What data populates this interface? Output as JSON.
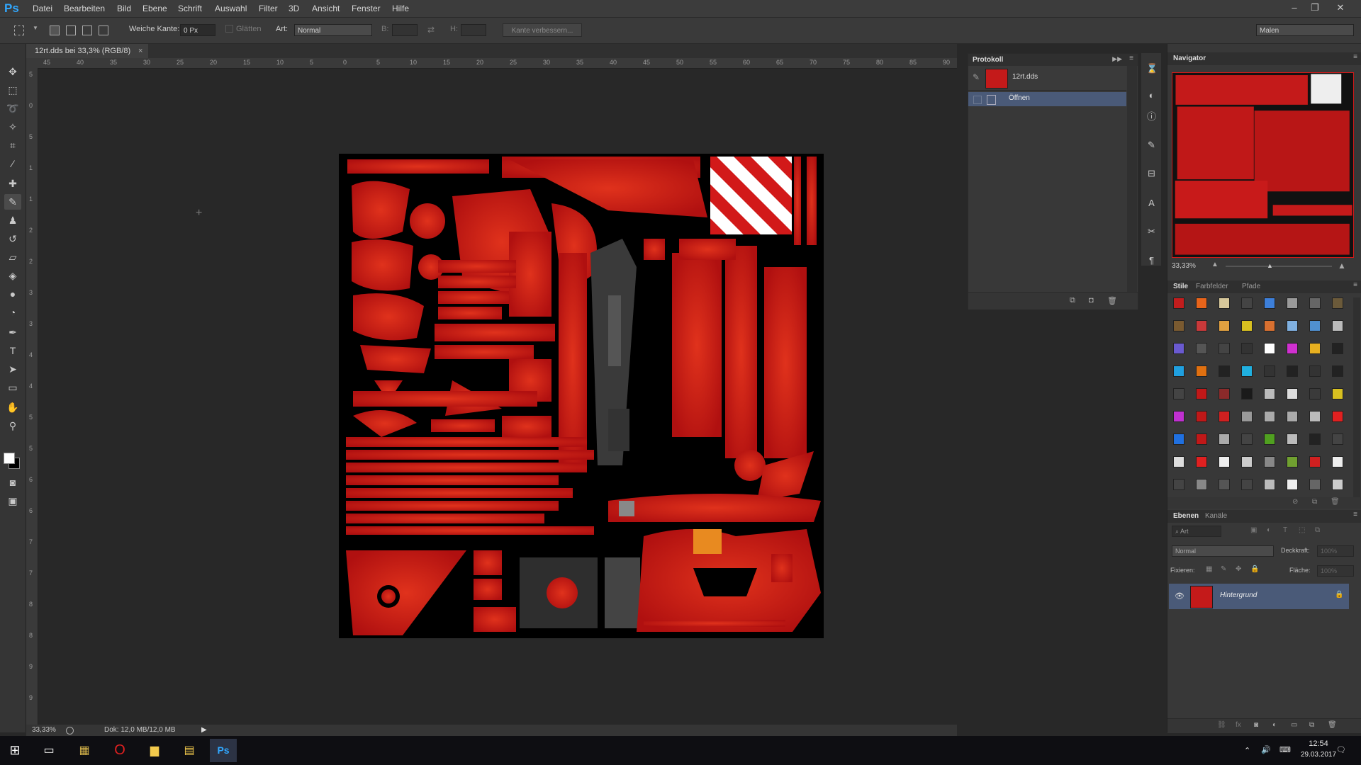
{
  "app": {
    "logo": "Ps"
  },
  "menu": [
    "Datei",
    "Bearbeiten",
    "Bild",
    "Ebene",
    "Schrift",
    "Auswahl",
    "Filter",
    "3D",
    "Ansicht",
    "Fenster",
    "Hilfe"
  ],
  "options": {
    "feather_label": "Weiche Kante:",
    "feather_value": "0 Px",
    "antialias_label": "Glätten",
    "style_label": "Art:",
    "style_value": "Normal",
    "width_label": "B:",
    "height_label": "H:",
    "refine_button": "Kante verbessern...",
    "workspace": "Malen"
  },
  "document": {
    "tab_title": "12rt.dds bei 33,3% (RGB/8)",
    "zoom": "33,33%",
    "doc_info": "Dok: 12,0 MB/12,0 MB"
  },
  "ruler_top": [
    "45",
    "40",
    "35",
    "30",
    "25",
    "20",
    "15",
    "10",
    "5",
    "0",
    "5",
    "10",
    "15",
    "20",
    "25",
    "30",
    "35",
    "40",
    "45",
    "50",
    "55",
    "60",
    "65",
    "70",
    "75",
    "80",
    "85",
    "90"
  ],
  "ruler_left": [
    "5",
    "0",
    "5",
    "1",
    "1",
    "2",
    "2",
    "3",
    "3",
    "4",
    "4",
    "5",
    "5",
    "6",
    "6",
    "7",
    "7",
    "8",
    "8",
    "9",
    "9"
  ],
  "history": {
    "title": "Protokoll",
    "snapshot": "12rt.dds",
    "items": [
      "Öffnen"
    ]
  },
  "navigator": {
    "title": "Navigator",
    "zoom": "33,33%"
  },
  "styles_panel": {
    "tabs": [
      "Stile",
      "Farbfelder",
      "Pfade"
    ]
  },
  "layers_panel": {
    "tabs": [
      "Ebenen",
      "Kanäle"
    ],
    "filter": "Art",
    "blend_mode": "Normal",
    "opacity_label": "Deckkraft:",
    "opacity_value": "100%",
    "lock_label": "Fixieren:",
    "fill_label": "Fläche:",
    "fill_value": "100%",
    "layer_name": "Hintergrund"
  },
  "taskbar": {
    "time": "12:54",
    "date": "29.03.2017"
  },
  "colors": {
    "accent_red": "#d21919",
    "selection_blue": "#4a5a78",
    "ps_blue": "#31a8ff"
  }
}
